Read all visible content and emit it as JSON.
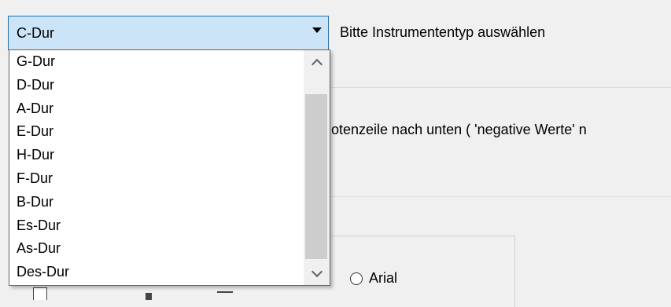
{
  "combo": {
    "selected": "C-Dur",
    "options": [
      "G-Dur",
      "D-Dur",
      "A-Dur",
      "E-Dur",
      "H-Dur",
      "F-Dur",
      "B-Dur",
      "Es-Dur",
      "As-Dur",
      "Des-Dur"
    ]
  },
  "instrument_label": "Bitte Instrumententyp auswählen",
  "note_text": "lotenzeile nach unten ( 'negative Werte' n",
  "radio_arial_label": "Arial",
  "colors": {
    "combo_bg": "#cce4f7",
    "combo_border": "#0078d7",
    "window_bg": "#f0f0f0"
  }
}
